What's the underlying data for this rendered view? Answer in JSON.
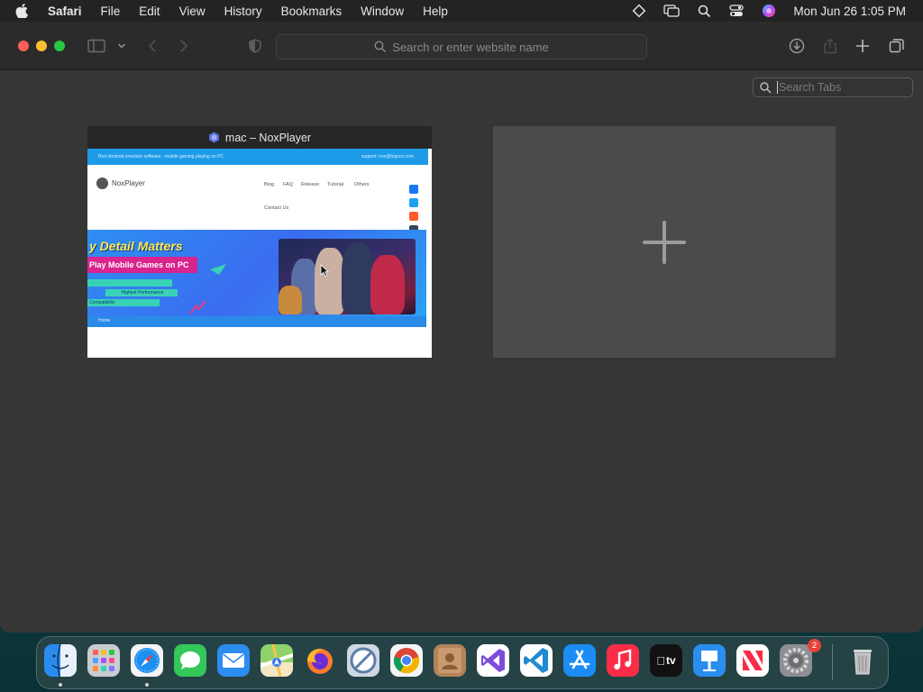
{
  "menubar": {
    "app_name": "Safari",
    "items": [
      "File",
      "Edit",
      "View",
      "History",
      "Bookmarks",
      "Window",
      "Help"
    ],
    "clock": "Mon Jun 26  1:05 PM"
  },
  "toolbar": {
    "address_placeholder": "Search or enter website name"
  },
  "tab_overview": {
    "search_placeholder": "Search Tabs",
    "tabs": [
      {
        "title": "mac – NoxPlayer",
        "page": {
          "top_left_text": "Best Android emulator software - mobile gaming playing on PC",
          "top_right_text": "support: nox@bignox.com",
          "logo_text": "NoxPlayer",
          "nav": [
            "Blog",
            "FAQ",
            "Release",
            "Tutorial",
            "Others"
          ],
          "nav_second_row": "Contact Us",
          "headline": "y Detail Matters",
          "subheadline": "Play Mobile Games on PC",
          "bullets": [
            "Highest Performance",
            "Compatibility"
          ],
          "home_link": "Home"
        }
      }
    ]
  },
  "dock": {
    "apps": [
      {
        "name": "Finder",
        "icon": "finder-icon",
        "running": true
      },
      {
        "name": "Launchpad",
        "icon": "launchpad-icon",
        "running": false
      },
      {
        "name": "Safari",
        "icon": "safari-icon",
        "running": true
      },
      {
        "name": "Messages",
        "icon": "messages-icon",
        "running": false
      },
      {
        "name": "Mail",
        "icon": "mail-icon",
        "running": false
      },
      {
        "name": "Maps",
        "icon": "maps-icon",
        "running": false
      },
      {
        "name": "Firefox",
        "icon": "firefox-icon",
        "running": false
      },
      {
        "name": "Network Radar",
        "icon": "radar-icon",
        "running": false
      },
      {
        "name": "Chrome",
        "icon": "chrome-icon",
        "running": false
      },
      {
        "name": "Contacts",
        "icon": "contacts-icon",
        "running": false
      },
      {
        "name": "Visual Studio",
        "icon": "visual-studio-icon",
        "running": false
      },
      {
        "name": "VS Code",
        "icon": "vscode-icon",
        "running": false
      },
      {
        "name": "App Store",
        "icon": "app-store-icon",
        "running": false
      },
      {
        "name": "Music",
        "icon": "music-icon",
        "running": false
      },
      {
        "name": "TV",
        "icon": "tv-icon",
        "running": false,
        "label": "tv"
      },
      {
        "name": "Keynote",
        "icon": "keynote-icon",
        "running": false
      },
      {
        "name": "News",
        "icon": "news-icon",
        "running": false
      },
      {
        "name": "System Settings",
        "icon": "settings-icon",
        "running": false,
        "badge": "2"
      },
      {
        "name": "Trash",
        "icon": "trash-icon",
        "running": false
      }
    ]
  },
  "colors": {
    "close": "#fe5f57",
    "minimize": "#febc2e",
    "zoom": "#28c840",
    "window_bg": "#363636"
  }
}
